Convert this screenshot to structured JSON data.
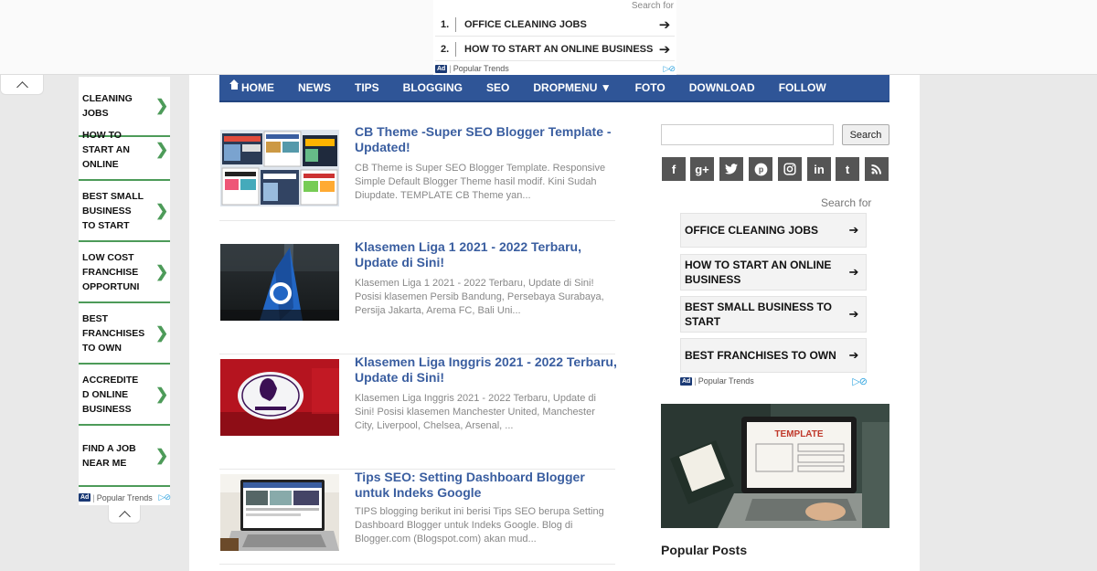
{
  "top_ad": {
    "search_for": "Search for",
    "items": [
      {
        "num": "1.",
        "label": "OFFICE CLEANING JOBS"
      },
      {
        "num": "2.",
        "label": "HOW TO START AN ONLINE BUSINESS"
      }
    ],
    "ad_badge": "Ad",
    "provider": "Popular Trends"
  },
  "nav": {
    "items": [
      "HOME",
      "NEWS",
      "TIPS",
      "BLOGGING",
      "SEO",
      "DROPMENU ▼",
      "FOTO",
      "DOWNLOAD",
      "FOLLOW"
    ]
  },
  "left_ad": {
    "items": [
      "CLEANING\nJOBS",
      "HOW TO\nSTART AN\nONLINE",
      "BEST SMALL\nBUSINESS\nTO START",
      "LOW COST\nFRANCHISE\nOPPORTUNI",
      "BEST\nFRANCHISES\nTO OWN",
      "ACCREDITE\nD ONLINE\nBUSINESS",
      "FIND A JOB\nNEAR ME"
    ],
    "arrow": "❯",
    "ad_badge": "Ad",
    "provider": "Popular Trends"
  },
  "posts": [
    {
      "title": "CB Theme -Super SEO Blogger Template - Updated!",
      "excerpt": "CB Theme is Super SEO Blogger Template. Responsive Simple Default Blogger Theme hasil modif. Kini Sudah Diupdate. TEMPLATE CB Theme yan..."
    },
    {
      "title": "Klasemen Liga 1 2021 - 2022 Terbaru, Update di Sini!",
      "excerpt": "Klasemen Liga 1 2021 - 2022 Terbaru, Update di Sini! Posisi klasemen Persib Bandung, Persebaya Surabaya, Persija Jakarta, Arema FC, Bali Uni..."
    },
    {
      "title": "Klasemen Liga Inggris 2021 - 2022 Terbaru, Update di Sini!",
      "excerpt": "Klasemen Liga Inggris 2021 - 2022 Terbaru, Update di Sini! Posisi klasemen Manchester United, Manchester City, Liverpool, Chelsea, Arsenal, ..."
    },
    {
      "title": "Tips SEO: Setting Dashboard Blogger untuk Indeks Google",
      "excerpt": "TIPS blogging berikut ini berisi Tips SEO berupa Setting Dashboard Blogger untuk Indeks Google. Blog di Blogger.com (Blogspot.com) akan mud..."
    }
  ],
  "sidebar": {
    "search_button": "Search",
    "search_placeholder": "",
    "social": [
      {
        "icon": "facebook-icon",
        "glyph": "f"
      },
      {
        "icon": "google-plus-icon",
        "glyph": "g+"
      },
      {
        "icon": "twitter-icon",
        "glyph": "t"
      },
      {
        "icon": "pinterest-icon",
        "glyph": "p"
      },
      {
        "icon": "instagram-icon",
        "glyph": "◘"
      },
      {
        "icon": "linkedin-icon",
        "glyph": "in"
      },
      {
        "icon": "tumblr-icon",
        "glyph": "t"
      },
      {
        "icon": "rss-icon",
        "glyph": "◥"
      }
    ],
    "ad": {
      "search_for": "Search for",
      "items": [
        "OFFICE CLEANING JOBS",
        "HOW TO START AN ONLINE\nBUSINESS",
        "BEST SMALL BUSINESS TO\nSTART",
        "BEST FRANCHISES TO OWN"
      ],
      "arrow": "➔",
      "ad_badge": "Ad",
      "provider": "Popular Trends"
    },
    "banner_text": "TEMPLATE",
    "popular_posts_title": "Popular Posts"
  },
  "colors": {
    "nav_bg": "#2f5597",
    "link": "#3a5ea0",
    "left_ad_accent": "#4d9b59",
    "social_bg": "#555555"
  }
}
